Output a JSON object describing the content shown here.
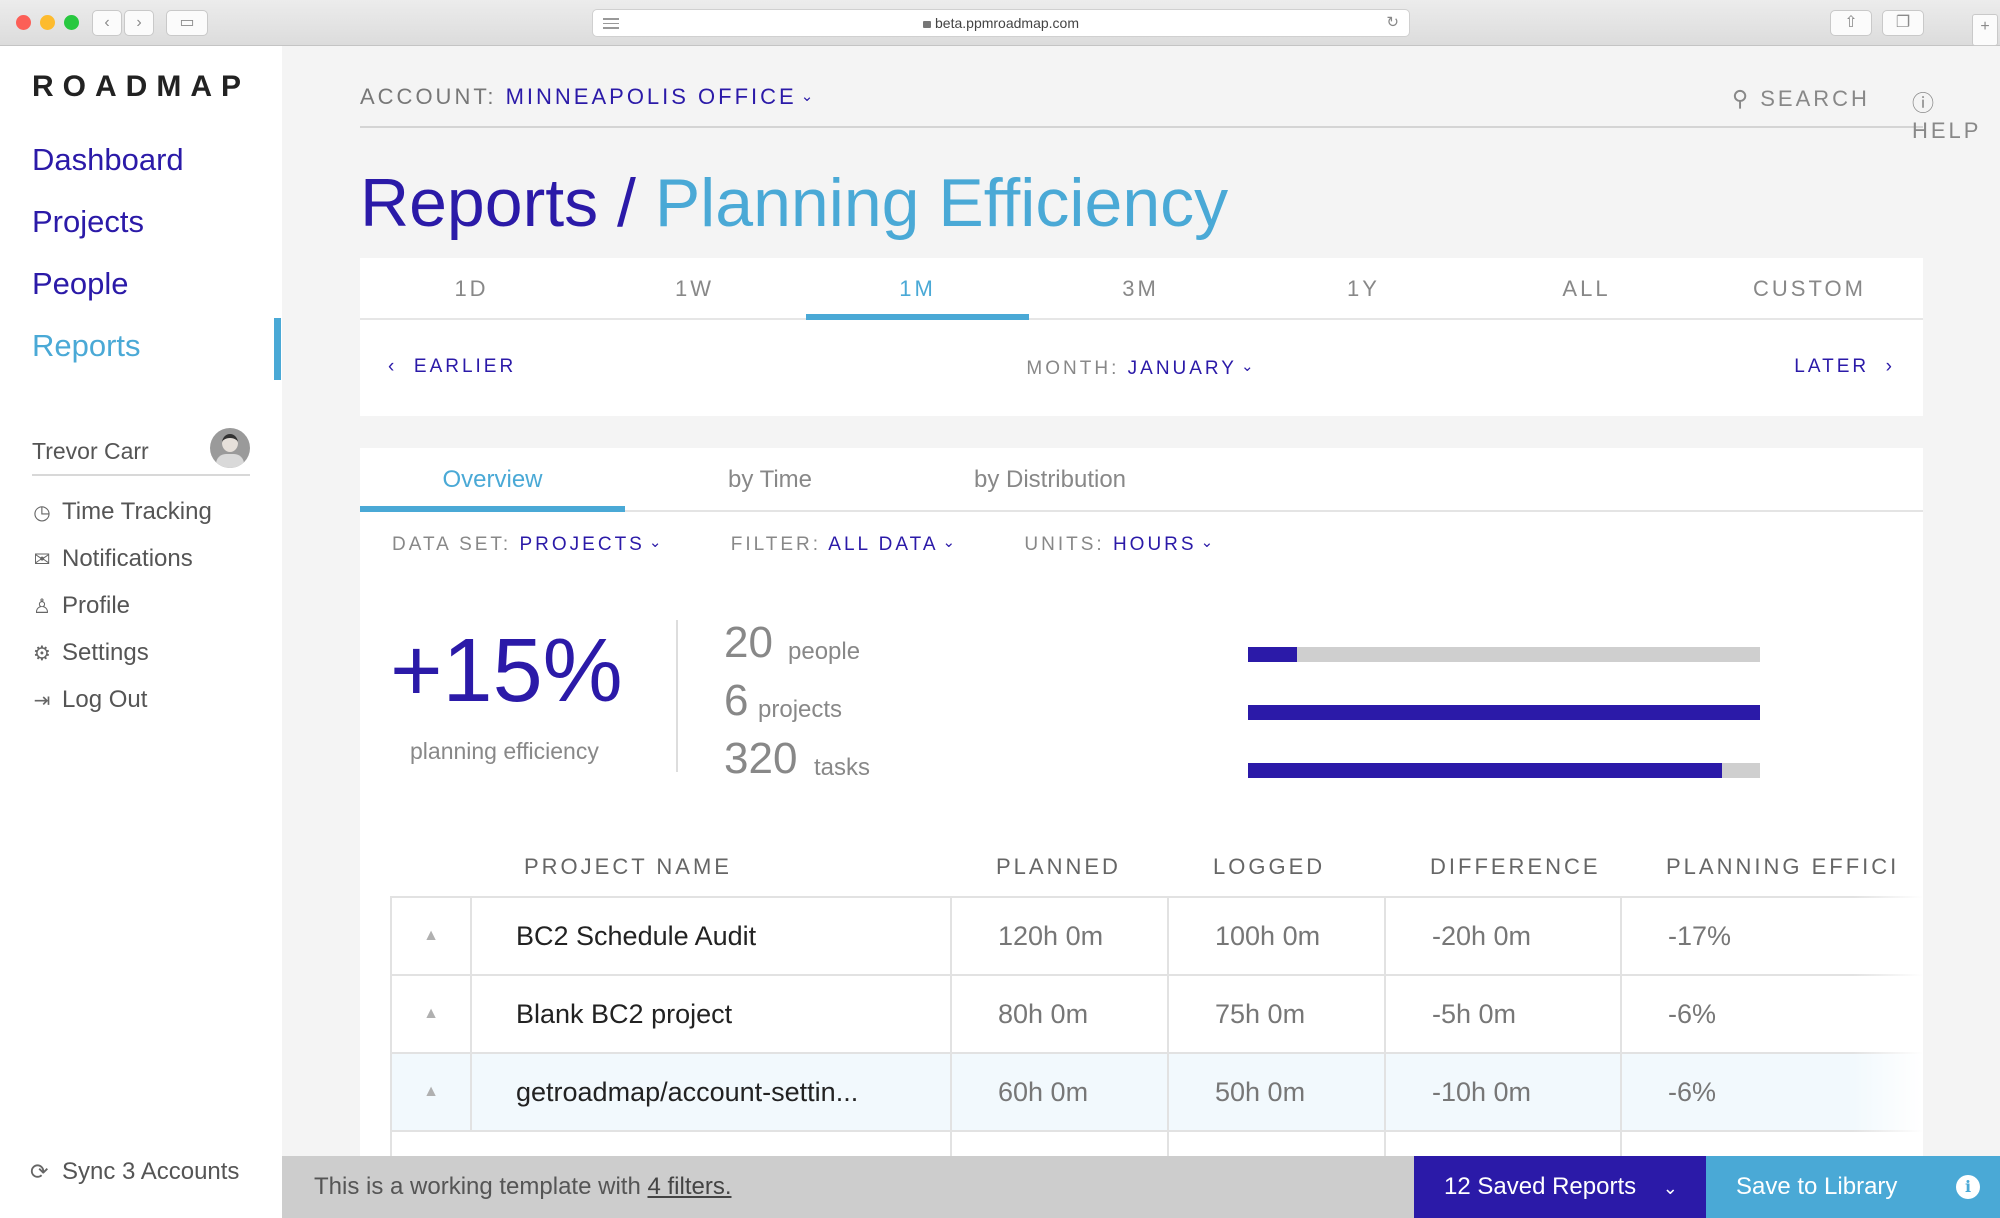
{
  "browser": {
    "url": "beta.ppmroadmap.com"
  },
  "sidebar": {
    "logo": "ROADMAP",
    "nav": [
      {
        "label": "Dashboard"
      },
      {
        "label": "Projects"
      },
      {
        "label": "People"
      },
      {
        "label": "Reports",
        "active": true
      }
    ],
    "user_name": "Trevor Carr",
    "menu": [
      {
        "icon": "clock-icon",
        "label": "Time Tracking"
      },
      {
        "icon": "envelope-icon",
        "label": "Notifications"
      },
      {
        "icon": "user-icon",
        "label": "Profile"
      },
      {
        "icon": "gear-icon",
        "label": "Settings"
      },
      {
        "icon": "logout-icon",
        "label": "Log Out"
      }
    ],
    "sync_label": "Sync 3 Accounts"
  },
  "topbar": {
    "account_label": "ACCOUNT:",
    "account_value": "MINNEAPOLIS OFFICE",
    "search_label": "SEARCH",
    "help_label": "HELP"
  },
  "page": {
    "title_main": "Reports",
    "title_sep": "/",
    "title_sub": "Planning Efficiency"
  },
  "period": {
    "range_tabs": [
      "1D",
      "1W",
      "1M",
      "3M",
      "1Y",
      "ALL",
      "CUSTOM"
    ],
    "active_range": "1M",
    "earlier_label": "EARLIER",
    "month_label": "MONTH:",
    "month_value": "JANUARY",
    "later_label": "LATER"
  },
  "report": {
    "view_tabs": [
      "Overview",
      "by Time",
      "by Distribution"
    ],
    "active_view": "Overview",
    "filters": [
      {
        "label": "DATA SET:",
        "value": "PROJECTS"
      },
      {
        "label": "FILTER:",
        "value": "ALL DATA"
      },
      {
        "label": "UNITS:",
        "value": "HOURS"
      }
    ],
    "summary": {
      "value": "+15%",
      "label": "planning efficiency"
    },
    "stats": [
      {
        "number": "20",
        "label": "people",
        "fill": 0.095
      },
      {
        "number": "6",
        "label": "projects",
        "fill": 1.0
      },
      {
        "number": "320",
        "label": "tasks",
        "fill": 0.925
      }
    ],
    "table": {
      "headers": [
        "PROJECT NAME",
        "PLANNED",
        "LOGGED",
        "DIFFERENCE",
        "PLANNING EFFICI"
      ],
      "rows": [
        {
          "name": "BC2 Schedule Audit",
          "planned": "120h 0m",
          "logged": "100h 0m",
          "difference": "-20h 0m",
          "efficiency": "-17%"
        },
        {
          "name": "Blank BC2 project",
          "planned": "80h 0m",
          "logged": "75h 0m",
          "difference": "-5h 0m",
          "efficiency": "-6%"
        },
        {
          "name": "getroadmap/account-settin...",
          "planned": "60h 0m",
          "logged": "50h 0m",
          "difference": "-10h 0m",
          "efficiency": "-6%",
          "highlighted": true
        }
      ]
    }
  },
  "footer": {
    "info_text": "This is a working template with",
    "info_link": "4 filters.",
    "saved_reports_label": "12 Saved Reports",
    "save_library_label": "Save to Library"
  },
  "colors": {
    "primary": "#2b1aa8",
    "accent": "#4aa9d6",
    "bar_track": "#cfcfcf"
  }
}
